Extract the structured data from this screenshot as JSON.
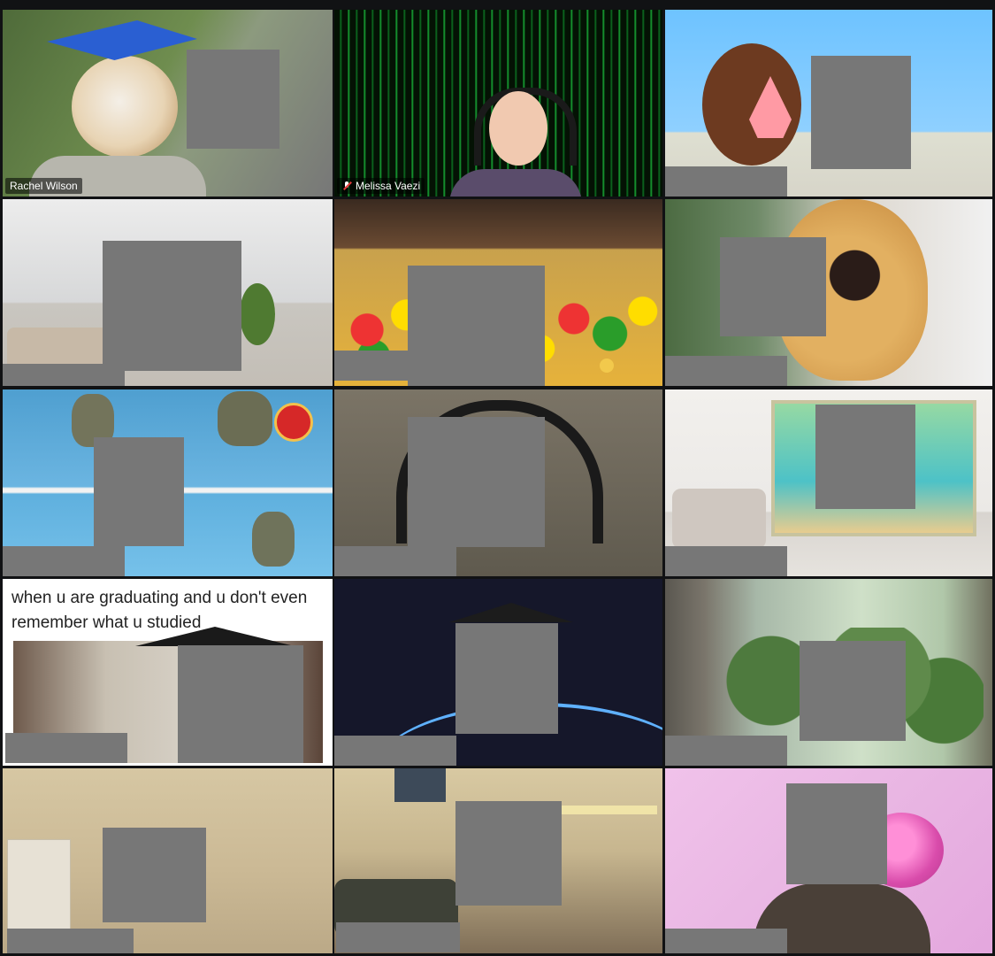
{
  "participants": [
    {
      "name": "Rachel Wilson",
      "muted": false,
      "active": true
    },
    {
      "name": "Melissa Vaezi",
      "muted": true,
      "active": false
    },
    {
      "name": "",
      "muted": false,
      "active": false
    },
    {
      "name": "",
      "muted": false,
      "active": false
    },
    {
      "name": "",
      "muted": false,
      "active": false
    },
    {
      "name": "",
      "muted": false,
      "active": false
    },
    {
      "name": "",
      "muted": false,
      "active": false
    },
    {
      "name": "",
      "muted": false,
      "active": false
    },
    {
      "name": "",
      "muted": false,
      "active": false
    },
    {
      "name": "",
      "muted": false,
      "active": false
    },
    {
      "name": "",
      "muted": false,
      "active": false
    },
    {
      "name": "",
      "muted": false,
      "active": false
    },
    {
      "name": "",
      "muted": false,
      "active": false
    },
    {
      "name": "",
      "muted": false,
      "active": false
    },
    {
      "name": "",
      "muted": false,
      "active": false
    }
  ],
  "meme": {
    "caption": "when u are graduating and u don't even remember what u studied"
  },
  "colors": {
    "active_border": "#e6ec6a",
    "redaction": "#777777",
    "window_bg": "#111214"
  },
  "icons": {
    "mute": "mic-off-icon",
    "award": "award-ribbon-icon"
  }
}
